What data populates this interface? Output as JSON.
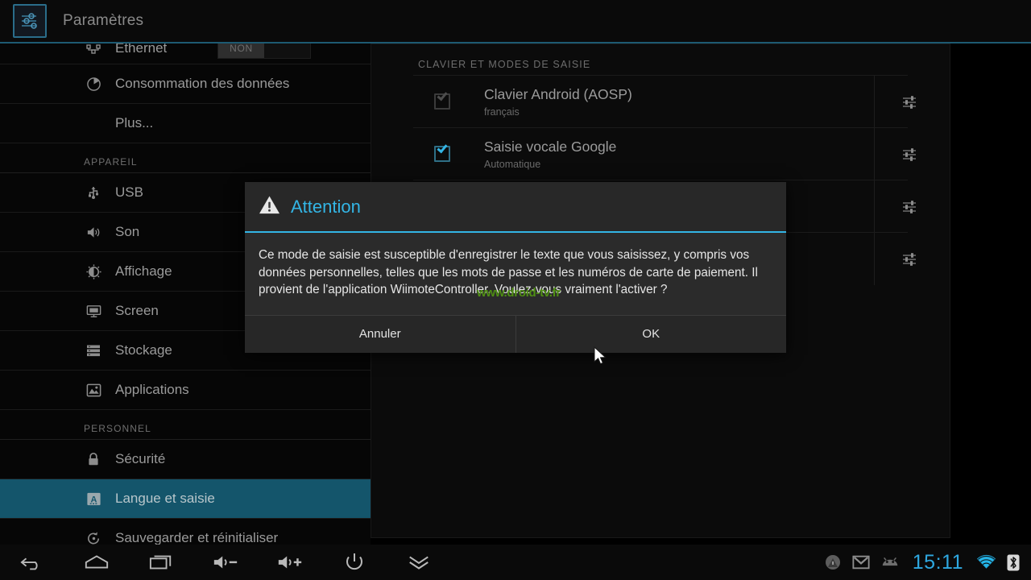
{
  "header": {
    "title": "Paramètres",
    "icon": "settings-sliders-icon"
  },
  "colors": {
    "accent_blue": "#33b5e5",
    "selected_row": "#14556b",
    "header_rule": "#1d5a72",
    "clock_blue": "#2fa8e0",
    "watermark_green": "#4f8f13"
  },
  "sidebar": {
    "items": [
      {
        "type": "row",
        "label": "Ethernet",
        "icon": "ethernet-icon",
        "toggle": "NON",
        "has_toggle": true
      },
      {
        "type": "row",
        "label": "Consommation des données",
        "icon": "data-usage-pie-icon"
      },
      {
        "type": "row",
        "label": "Plus...",
        "icon": null
      },
      {
        "type": "header",
        "label": "APPAREIL"
      },
      {
        "type": "row",
        "label": "USB",
        "icon": "usb-icon"
      },
      {
        "type": "row",
        "label": "Son",
        "icon": "sound-speaker-icon"
      },
      {
        "type": "row",
        "label": "Affichage",
        "icon": "brightness-icon"
      },
      {
        "type": "row",
        "label": "Screen",
        "icon": "monitor-icon"
      },
      {
        "type": "row",
        "label": "Stockage",
        "icon": "storage-icon"
      },
      {
        "type": "row",
        "label": "Applications",
        "icon": "applications-image-icon"
      },
      {
        "type": "header",
        "label": "PERSONNEL"
      },
      {
        "type": "row",
        "label": "Sécurité",
        "icon": "lock-icon"
      },
      {
        "type": "row",
        "label": "Langue et saisie",
        "icon": "language-a-icon",
        "selected": true
      },
      {
        "type": "row",
        "label": "Sauvegarder et réinitialiser",
        "icon": "backup-reset-icon"
      }
    ]
  },
  "content": {
    "section_title": "CLAVIER ET MODES DE SAISIE",
    "rows": [
      {
        "title": "Clavier Android (AOSP)",
        "subtitle": "français",
        "checked": true,
        "checkbox_state": "disabled",
        "settings_icon": "sliders-settings-icon"
      },
      {
        "title": "Saisie vocale Google",
        "subtitle": "Automatique",
        "checked": true,
        "checkbox_state": "active",
        "settings_icon": "sliders-settings-icon"
      },
      {
        "title": "",
        "subtitle": "",
        "checked": false,
        "checkbox_state": "hidden",
        "settings_icon": "sliders-settings-icon"
      },
      {
        "title": "",
        "subtitle": "",
        "checked": false,
        "checkbox_state": "hidden",
        "settings_icon": "sliders-settings-icon"
      }
    ]
  },
  "dialog": {
    "title": "Attention",
    "icon": "warning-triangle-icon",
    "message": "Ce mode de saisie est susceptible d'enregistrer le texte que vous saisissez, y compris vos données personnelles, telles que les mots de passe et les numéros de carte de paiement. Il provient de l'application WiimoteController. Voulez-vous vraiment l'activer ?",
    "cancel_label": "Annuler",
    "ok_label": "OK"
  },
  "watermark": {
    "text": "www.droid-tv.fr"
  },
  "navbar": {
    "buttons": [
      {
        "name": "back-icon",
        "label": "Retour"
      },
      {
        "name": "home-icon",
        "label": "Accueil"
      },
      {
        "name": "recents-icon",
        "label": "Applications récentes"
      },
      {
        "name": "volume-down-icon",
        "label": "Volume -"
      },
      {
        "name": "volume-up-icon",
        "label": "Volume +"
      },
      {
        "name": "power-icon",
        "label": "Alimentation"
      },
      {
        "name": "collapse-chevron-icon",
        "label": "Réduire"
      }
    ],
    "status": {
      "time": "15:11",
      "icons": [
        {
          "name": "warning-circle-icon"
        },
        {
          "name": "gmail-icon"
        },
        {
          "name": "android-robot-icon"
        },
        {
          "name": "wifi-icon"
        },
        {
          "name": "bluetooth-icon"
        }
      ]
    }
  }
}
